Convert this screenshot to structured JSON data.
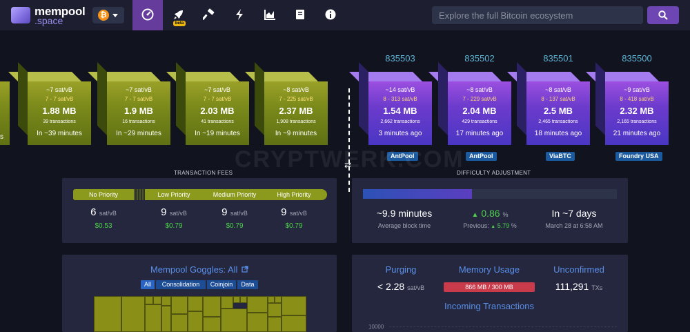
{
  "brand": {
    "line1": "mempool",
    "line2": ".space"
  },
  "network": {
    "symbol": "₿"
  },
  "nav": {
    "items": [
      {
        "icon": "dashboard-icon"
      },
      {
        "icon": "rocket-icon",
        "badge": "beta"
      },
      {
        "icon": "hammer-icon"
      },
      {
        "icon": "lightning-icon"
      },
      {
        "icon": "chart-icon"
      },
      {
        "icon": "book-icon"
      },
      {
        "icon": "info-icon"
      }
    ]
  },
  "search": {
    "placeholder": "Explore the full Bitcoin ecosystem"
  },
  "left_cut": {
    "text": "s"
  },
  "mempool_blocks": [
    {
      "fee": "~7 sat/vB",
      "range": "7 - 7 sat/vB",
      "size": "1.88 MB",
      "tx": "39 transactions",
      "eta": "In ~39 minutes"
    },
    {
      "fee": "~7 sat/vB",
      "range": "7 - 7 sat/vB",
      "size": "1.9 MB",
      "tx": "16 transactions",
      "eta": "In ~29 minutes"
    },
    {
      "fee": "~7 sat/vB",
      "range": "7 - 7 sat/vB",
      "size": "2.03 MB",
      "tx": "41 transactions",
      "eta": "In ~19 minutes"
    },
    {
      "fee": "~8 sat/vB",
      "range": "7 - 225 sat/vB",
      "size": "2.37 MB",
      "tx": "1,908 transactions",
      "eta": "In ~9 minutes"
    }
  ],
  "mined_blocks": [
    {
      "height": "835503",
      "fee": "~14 sat/vB",
      "range": "8 - 313 sat/vB",
      "size": "1.54 MB",
      "tx": "2,662 transactions",
      "ago": "3 minutes ago",
      "pool": "AntPool"
    },
    {
      "height": "835502",
      "fee": "~8 sat/vB",
      "range": "7 - 229 sat/vB",
      "size": "2.04 MB",
      "tx": "429 transactions",
      "ago": "17 minutes ago",
      "pool": "AntPool"
    },
    {
      "height": "835501",
      "fee": "~8 sat/vB",
      "range": "8 - 137 sat/vB",
      "size": "2.5 MB",
      "tx": "2,465 transactions",
      "ago": "18 minutes ago",
      "pool": "ViaBTC"
    },
    {
      "height": "835500",
      "fee": "~9 sat/vB",
      "range": "8 - 418 sat/vB",
      "size": "2.32 MB",
      "tx": "2,165 transactions",
      "ago": "21 minutes ago",
      "pool": "Foundry USA"
    }
  ],
  "watermark": "CRYPTWERK.COM",
  "fees": {
    "title": "TRANSACTION FEES",
    "no_priority": {
      "label": "No Priority",
      "value": "6",
      "unit": "sat/vB",
      "usd": "$0.53"
    },
    "low": {
      "label": "Low Priority",
      "value": "9",
      "unit": "sat/vB",
      "usd": "$0.79"
    },
    "medium": {
      "label": "Medium Priority",
      "value": "9",
      "unit": "sat/vB",
      "usd": "$0.79"
    },
    "high": {
      "label": "High Priority",
      "value": "9",
      "unit": "sat/vB",
      "usd": "$0.79"
    }
  },
  "difficulty": {
    "title": "DIFFICULTY ADJUSTMENT",
    "progress_fraction": 0.43,
    "block_time": "~9.9 minutes",
    "block_time_label": "Average block time",
    "change_arrow": "▲",
    "change": "0.86",
    "change_unit": "%",
    "previous_label": "Previous:",
    "previous_arrow": "▲",
    "previous": "5.79",
    "previous_unit": "%",
    "eta": "In ~7 days",
    "eta_date": "March 28 at 6:58 AM"
  },
  "goggles": {
    "title": "Mempool Goggles: All",
    "tabs": [
      "All",
      "Consolidation",
      "Coinjoin",
      "Data"
    ]
  },
  "mempool_info": {
    "purging_label": "Purging",
    "purging_value": "< 2.28",
    "purging_unit": "sat/vB",
    "memory_label": "Memory Usage",
    "memory_value": "866 MB / 300 MB",
    "unconfirmed_label": "Unconfirmed",
    "unconfirmed_value": "111,291",
    "unconfirmed_unit": "TXs",
    "incoming_title": "Incoming Transactions",
    "axis_top": "10000"
  },
  "colors": {
    "accent": "#653b9c",
    "link": "#5a8fe8",
    "green": "#4fd14b",
    "pool_tag": "#1b5a9e"
  }
}
